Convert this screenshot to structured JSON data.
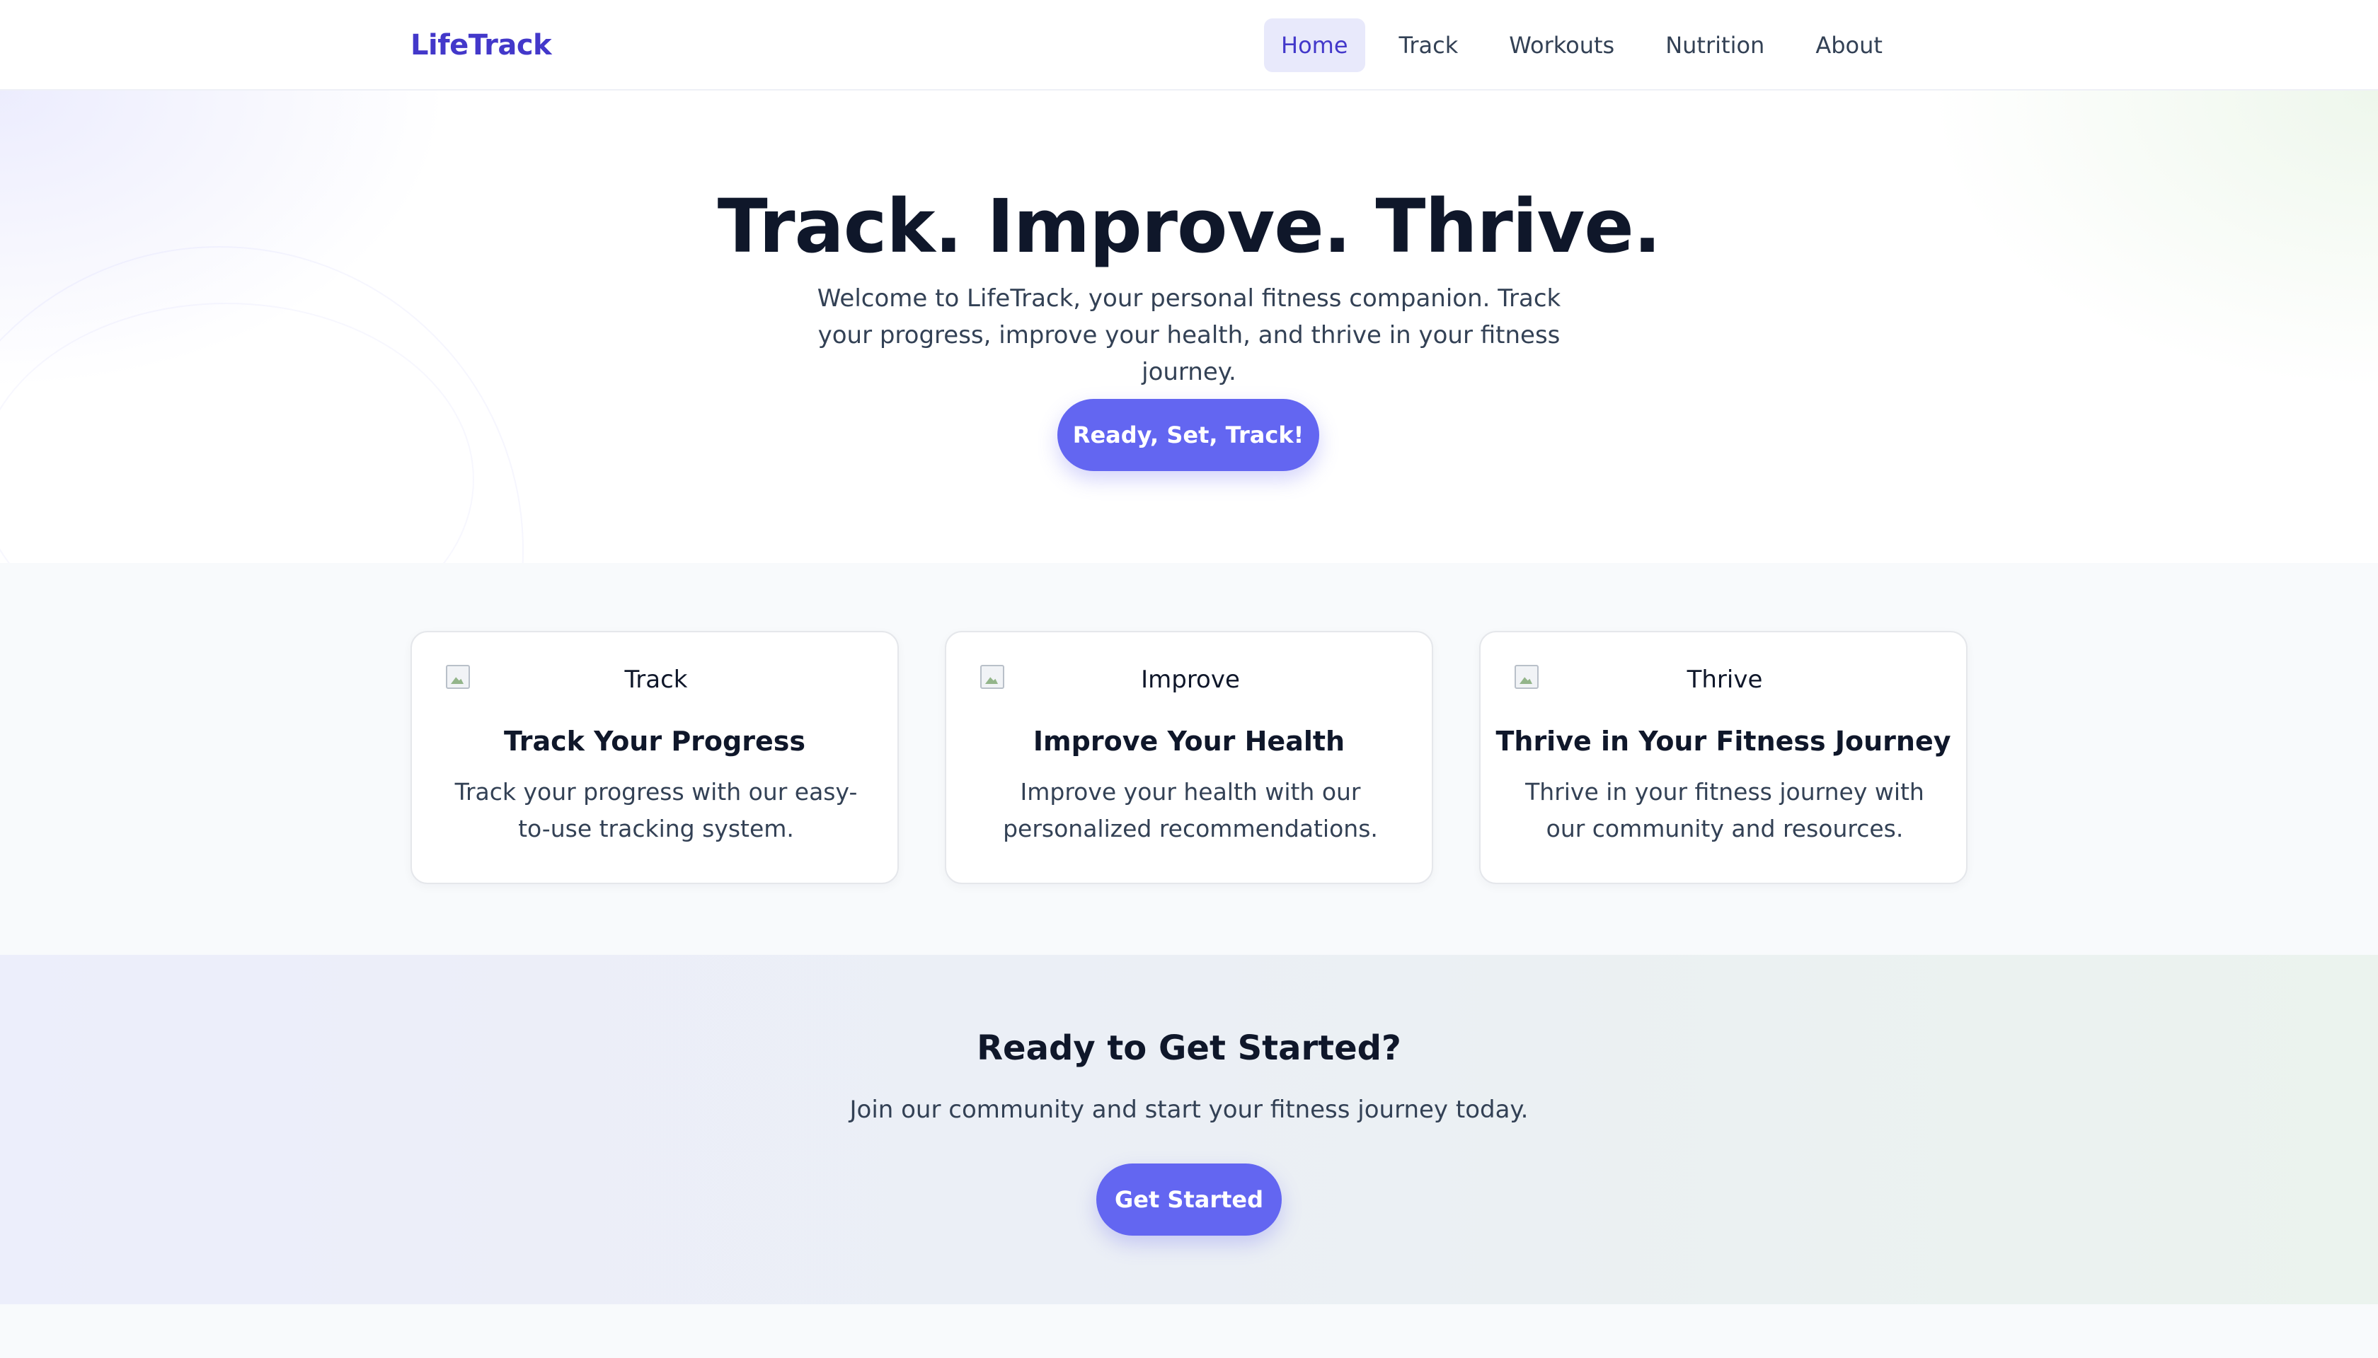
{
  "header": {
    "logo": "LifeTrack",
    "nav": [
      {
        "label": "Home",
        "active": true
      },
      {
        "label": "Track",
        "active": false
      },
      {
        "label": "Workouts",
        "active": false
      },
      {
        "label": "Nutrition",
        "active": false
      },
      {
        "label": "About",
        "active": false
      }
    ]
  },
  "hero": {
    "title": "Track. Improve. Thrive.",
    "subtitle": "Welcome to LifeTrack, your personal fitness companion. Track your progress, improve your health, and thrive in your fitness journey.",
    "button_label": "Ready, Set, Track!"
  },
  "features": [
    {
      "image_alt": "Track",
      "image_icon": "broken-image-icon",
      "title": "Track Your Progress",
      "text": "Track your progress with our easy-to-use tracking system."
    },
    {
      "image_alt": "Improve",
      "image_icon": "broken-image-icon",
      "title": "Improve Your Health",
      "text": "Improve your health with our personalized recommendations."
    },
    {
      "image_alt": "Thrive",
      "image_icon": "broken-image-icon",
      "title": "Thrive in Your Fitness Journey",
      "text": "Thrive in your fitness journey with our community and resources."
    }
  ],
  "cta": {
    "title": "Ready to Get Started?",
    "subtitle": "Join our community and start your fitness journey today.",
    "button_label": "Get Started"
  },
  "colors": {
    "brand": "#4338ca",
    "accent": "#6366f1",
    "nav_active_bg": "#e8e9fb",
    "text_dark": "#0f172a",
    "text_body": "#334155"
  }
}
